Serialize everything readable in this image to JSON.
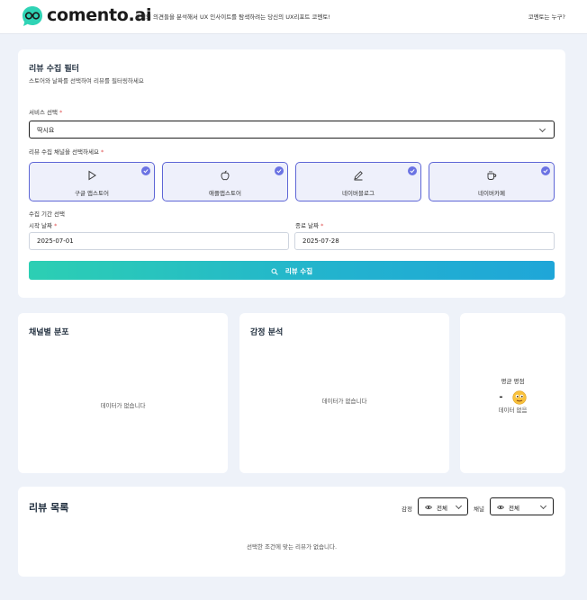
{
  "header": {
    "brand": "comento.ai",
    "tagline": "고객의 의견들을 분석해서 UX 인사이트를 탐색하려는 당신의 UX리포트 코멘토!",
    "help_link": "코멘토는 누구?",
    "brand_color": "#2ccfb3"
  },
  "filter": {
    "title": "리뷰 수집 필터",
    "subtitle": "스토어와 날짜를 선택하여 리뷰를 필터링하세요",
    "service_label": "서비스 선택",
    "required_mark": "*",
    "service_value": "딱시요",
    "channel_label": "리뷰 수집 채널을 선택하세요",
    "channels": [
      {
        "label": "구글 앱스토어",
        "icon": "play-icon",
        "checked": true
      },
      {
        "label": "애플앱스토어",
        "icon": "apple-icon",
        "checked": true
      },
      {
        "label": "네이버블로그",
        "icon": "pencil-icon",
        "checked": true
      },
      {
        "label": "네이버카페",
        "icon": "coffee-icon",
        "checked": true
      }
    ],
    "period_label": "수집 기간 선택",
    "start_label": "시작 날짜",
    "start_value": "2025-07-01",
    "end_label": "종료 날짜",
    "end_value": "2025-07-28",
    "submit_label": "리뷰 수집",
    "accent_color": "#5e66d6"
  },
  "charts": {
    "channel_title": "채널별 분포",
    "channel_empty": "데이터가 없습니다",
    "sentiment_title": "감정 분석",
    "sentiment_empty": "데이터가 없습니다",
    "rating_label": "평균 평점",
    "rating_value": "-",
    "rating_empty": "데이터 없음"
  },
  "review_list": {
    "title": "리뷰 목록",
    "sentiment_filter_label": "감정",
    "sentiment_filter_value": "전체",
    "channel_filter_label": "채널",
    "channel_filter_value": "전체",
    "empty": "선택한 조건에 맞는 리뷰가 없습니다."
  }
}
